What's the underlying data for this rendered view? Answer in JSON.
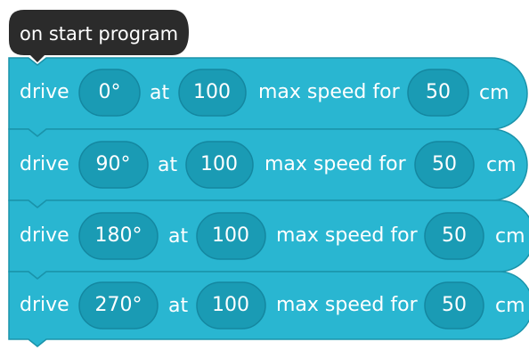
{
  "colors": {
    "block": "#29b6d1",
    "block_border": "#1a93aa",
    "pill": "#1a9bb4",
    "pill_border": "#1487a0",
    "hat": "#2b2b2b",
    "text": "#ffffff"
  },
  "hat": {
    "label": "on start program"
  },
  "blocks": [
    {
      "cmd": "drive",
      "angle": "0°",
      "at": "at",
      "speed": "100",
      "mid": "max speed for",
      "distance": "50",
      "unit": "cm"
    },
    {
      "cmd": "drive",
      "angle": "90°",
      "at": "at",
      "speed": "100",
      "mid": "max speed for",
      "distance": "50",
      "unit": "cm"
    },
    {
      "cmd": "drive",
      "angle": "180°",
      "at": "at",
      "speed": "100",
      "mid": "max speed for",
      "distance": "50",
      "unit": "cm"
    },
    {
      "cmd": "drive",
      "angle": "270°",
      "at": "at",
      "speed": "100",
      "mid": "max speed for",
      "distance": "50",
      "unit": "cm"
    }
  ]
}
